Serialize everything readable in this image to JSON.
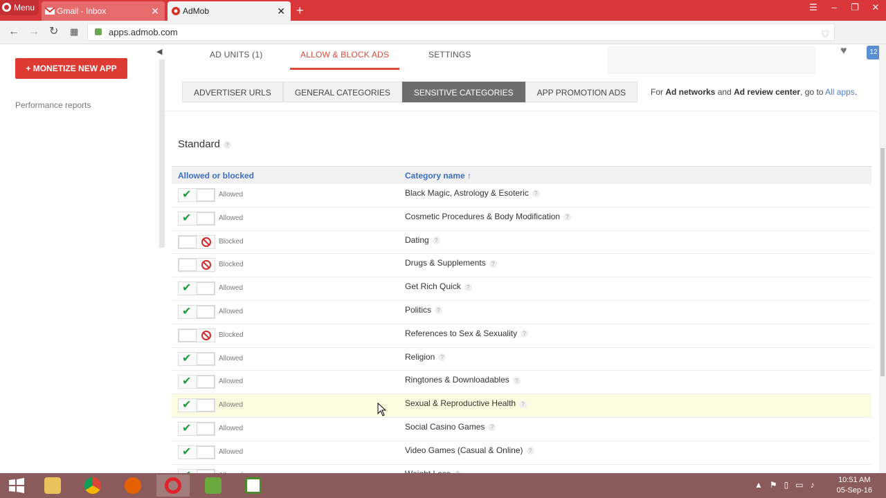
{
  "browser": {
    "menu_label": "Menu",
    "tabs": [
      {
        "label": "Gmail - Inbox"
      },
      {
        "label": "AdMob"
      }
    ],
    "url": "apps.admob.com"
  },
  "sidebar": {
    "monetize_label": "+ MONETIZE NEW APP",
    "performance_label": "Performance reports"
  },
  "top_tabs": [
    "AD UNITS (1)",
    "ALLOW & BLOCK ADS",
    "SETTINGS"
  ],
  "sub_tabs": [
    "ADVERTISER URLS",
    "GENERAL CATEGORIES",
    "SENSITIVE CATEGORIES",
    "APP PROMOTION ADS"
  ],
  "network_note": {
    "p1": "For ",
    "b1": "Ad networks",
    "p2": " and ",
    "b2": "Ad review center",
    "p3": ", go to ",
    "link": "All apps",
    "p4": "."
  },
  "section_title": "Standard",
  "table": {
    "col1": "Allowed or blocked",
    "col2": "Category name",
    "rows": [
      {
        "state": "Allowed",
        "name": "Black Magic, Astrology & Esoteric"
      },
      {
        "state": "Allowed",
        "name": "Cosmetic Procedures & Body Modification"
      },
      {
        "state": "Blocked",
        "name": "Dating"
      },
      {
        "state": "Blocked",
        "name": "Drugs & Supplements"
      },
      {
        "state": "Allowed",
        "name": "Get Rich Quick"
      },
      {
        "state": "Allowed",
        "name": "Politics"
      },
      {
        "state": "Blocked",
        "name": "References to Sex & Sexuality"
      },
      {
        "state": "Allowed",
        "name": "Religion"
      },
      {
        "state": "Allowed",
        "name": "Ringtones & Downloadables"
      },
      {
        "state": "Allowed",
        "name": "Sexual & Reproductive Health"
      },
      {
        "state": "Allowed",
        "name": "Social Casino Games"
      },
      {
        "state": "Allowed",
        "name": "Video Games (Casual & Online)"
      },
      {
        "state": "Allowed",
        "name": "Weight Loss"
      }
    ]
  },
  "clock": {
    "time": "10:51 AM",
    "date": "05-Sep-16"
  },
  "colors": {
    "accent": "#dd4b39",
    "link": "#3b6ec5",
    "allowed": "#1e9e3e",
    "blocked": "#d12b2b"
  }
}
